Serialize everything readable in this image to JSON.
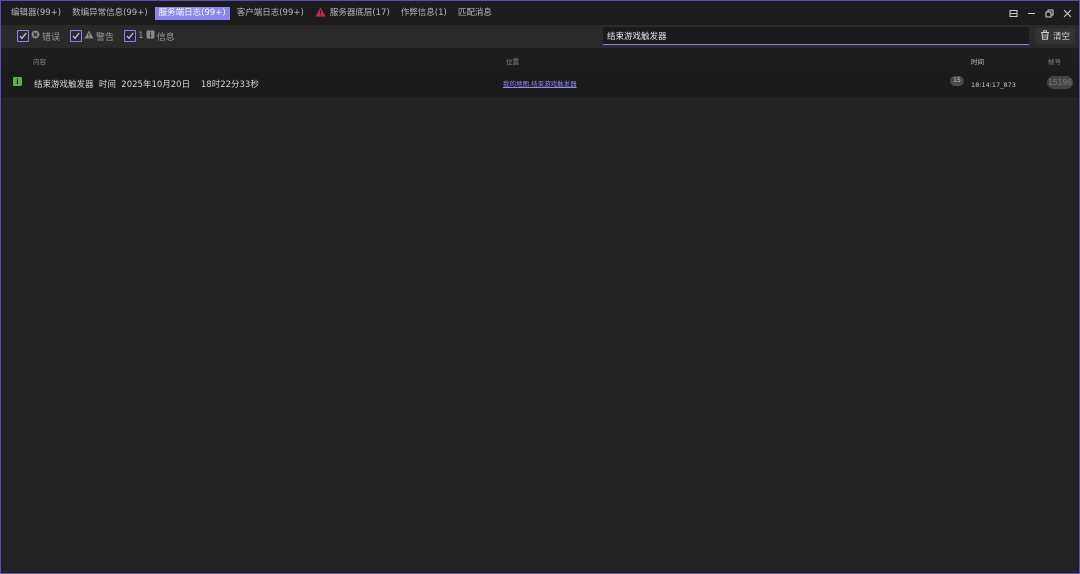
{
  "tabs": [
    {
      "label": "编辑器(99+)",
      "active": false,
      "warn": false
    },
    {
      "label": "数编异常信息(99+)",
      "active": false,
      "warn": false
    },
    {
      "label": "服务端日志(99+)",
      "active": true,
      "warn": false
    },
    {
      "label": "客户端日志(99+)",
      "active": false,
      "warn": false
    },
    {
      "label": "服务器底层(17)",
      "active": false,
      "warn": true
    },
    {
      "label": "作弊信息(1)",
      "active": false,
      "warn": false
    },
    {
      "label": "匹配消息",
      "active": false,
      "warn": false
    }
  ],
  "filters": {
    "error": {
      "label": "错误",
      "checked": true
    },
    "warning": {
      "label": "警告",
      "checked": true
    },
    "info": {
      "label": "信息",
      "count": "1",
      "checked": true
    }
  },
  "search": {
    "value": "结束游戏触发器"
  },
  "clear_label": "清空",
  "columns": {
    "content": "内容",
    "location": "位置",
    "time": "时间",
    "frame": "帧号"
  },
  "rows": [
    {
      "message": "结束游戏触发器  时间  2025年10月20日    18时22分33秒",
      "location": "我的地图.结束游戏触发器",
      "count": "15",
      "time": "18:14:17_873",
      "frame": "15196"
    }
  ],
  "colors": {
    "accent": "#8b84ef",
    "info_icon": "#5fae4c",
    "warn_icon": "#d8244a"
  },
  "icons": {
    "error": "error-circle-icon",
    "warning": "warning-triangle-icon",
    "info": "info-square-icon",
    "clear": "trash-icon"
  }
}
